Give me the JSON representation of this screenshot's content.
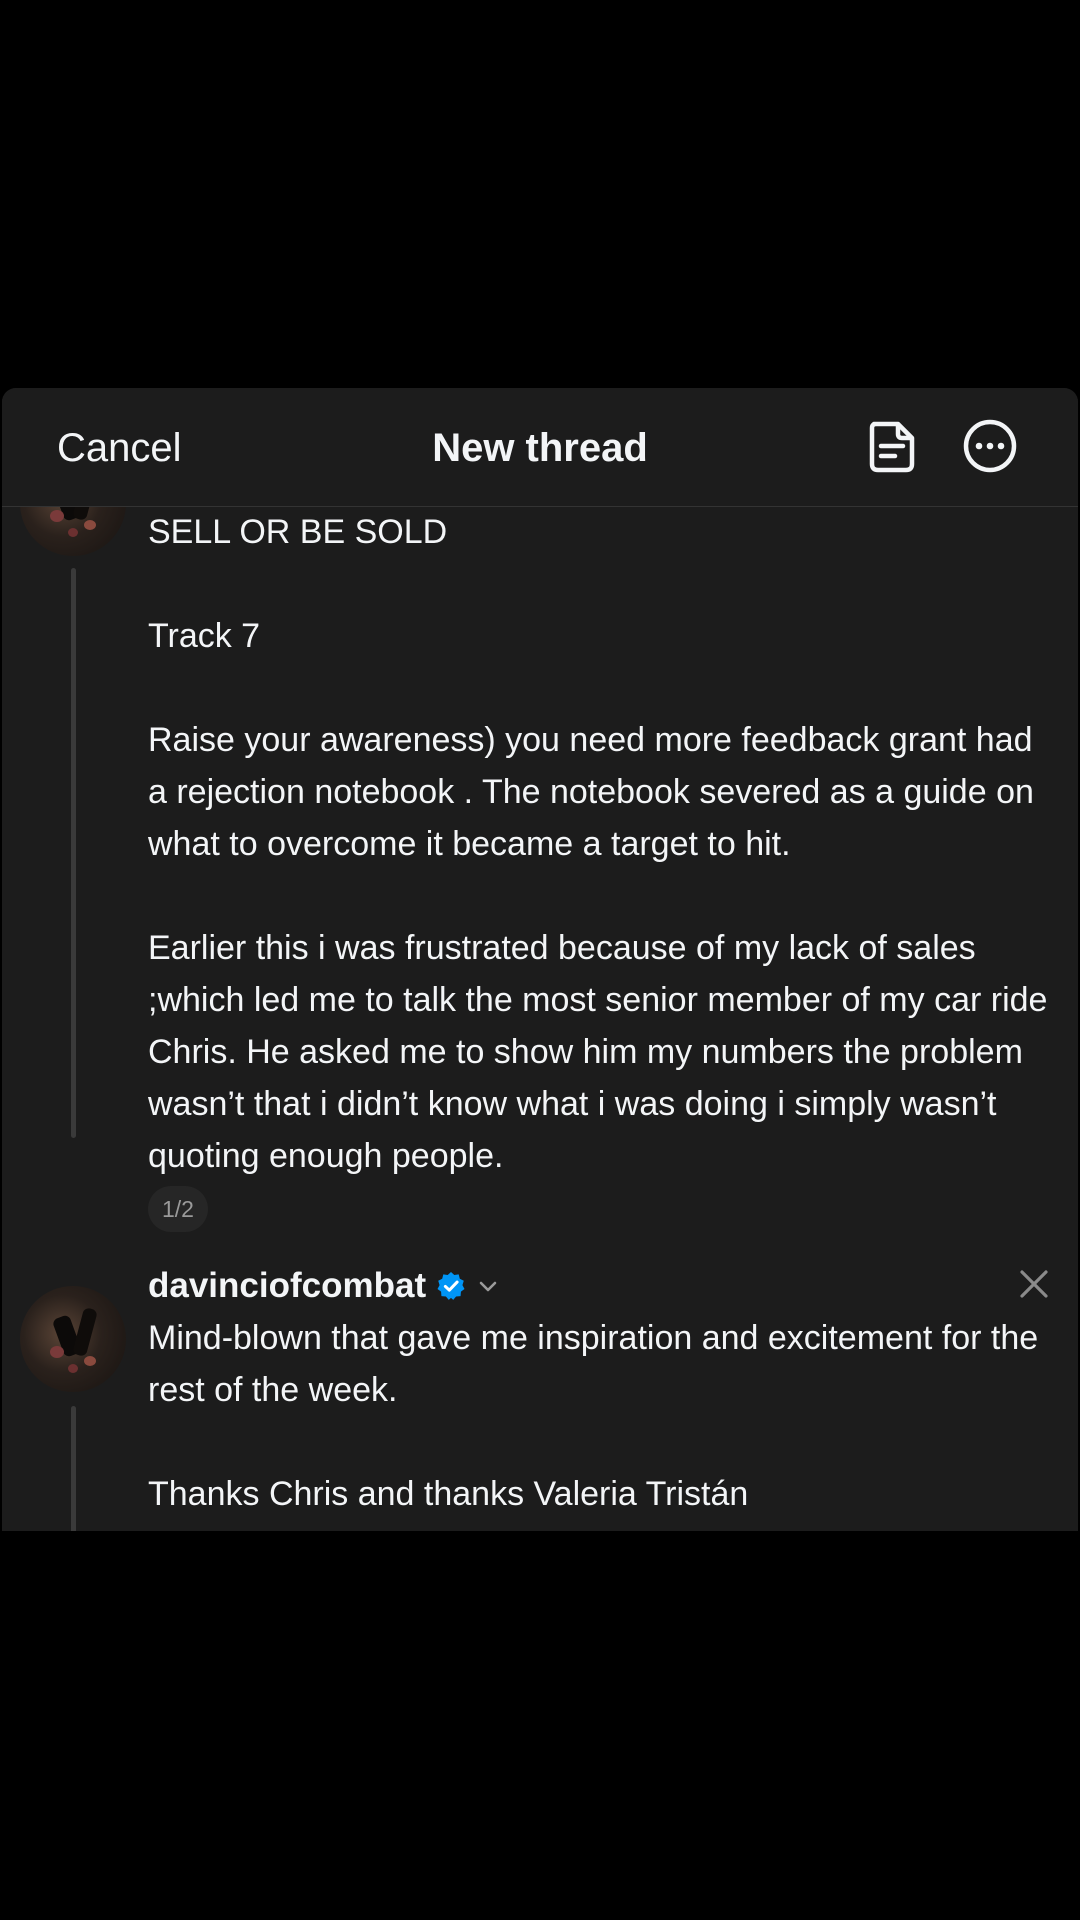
{
  "header": {
    "cancel_label": "Cancel",
    "title": "New thread",
    "drafts_icon": "drafts-icon",
    "more_icon": "more-options-icon"
  },
  "posts": [
    {
      "paragraphs": [
        "SELL OR BE SOLD",
        "",
        "Track 7",
        "",
        "Raise your awareness) you need more feedback grant had a rejection notebook . The notebook severed as a guide on what to overcome it became a target to hit.",
        "",
        "Earlier this i was frustrated because of my lack of sales ;which led me to talk the most senior member of my car ride Chris. He asked me to show him my numbers the problem wasn’t that i didn’t know what i was doing i simply wasn’t quoting enough people."
      ],
      "page_indicator": "1/2"
    },
    {
      "username": "davinciofcombat",
      "verified": true,
      "paragraphs": [
        "Mind-blown that gave me inspiration and excitement for the rest of the week.",
        "",
        "Thanks Chris and thanks Valeria Tristán"
      ]
    }
  ],
  "colors": {
    "background": "#000000",
    "sheet": "#1c1c1c",
    "text": "#f3f5f7",
    "thread_line": "#3a3a3a",
    "verified": "#0095f6",
    "muted": "#9a9a9a"
  }
}
